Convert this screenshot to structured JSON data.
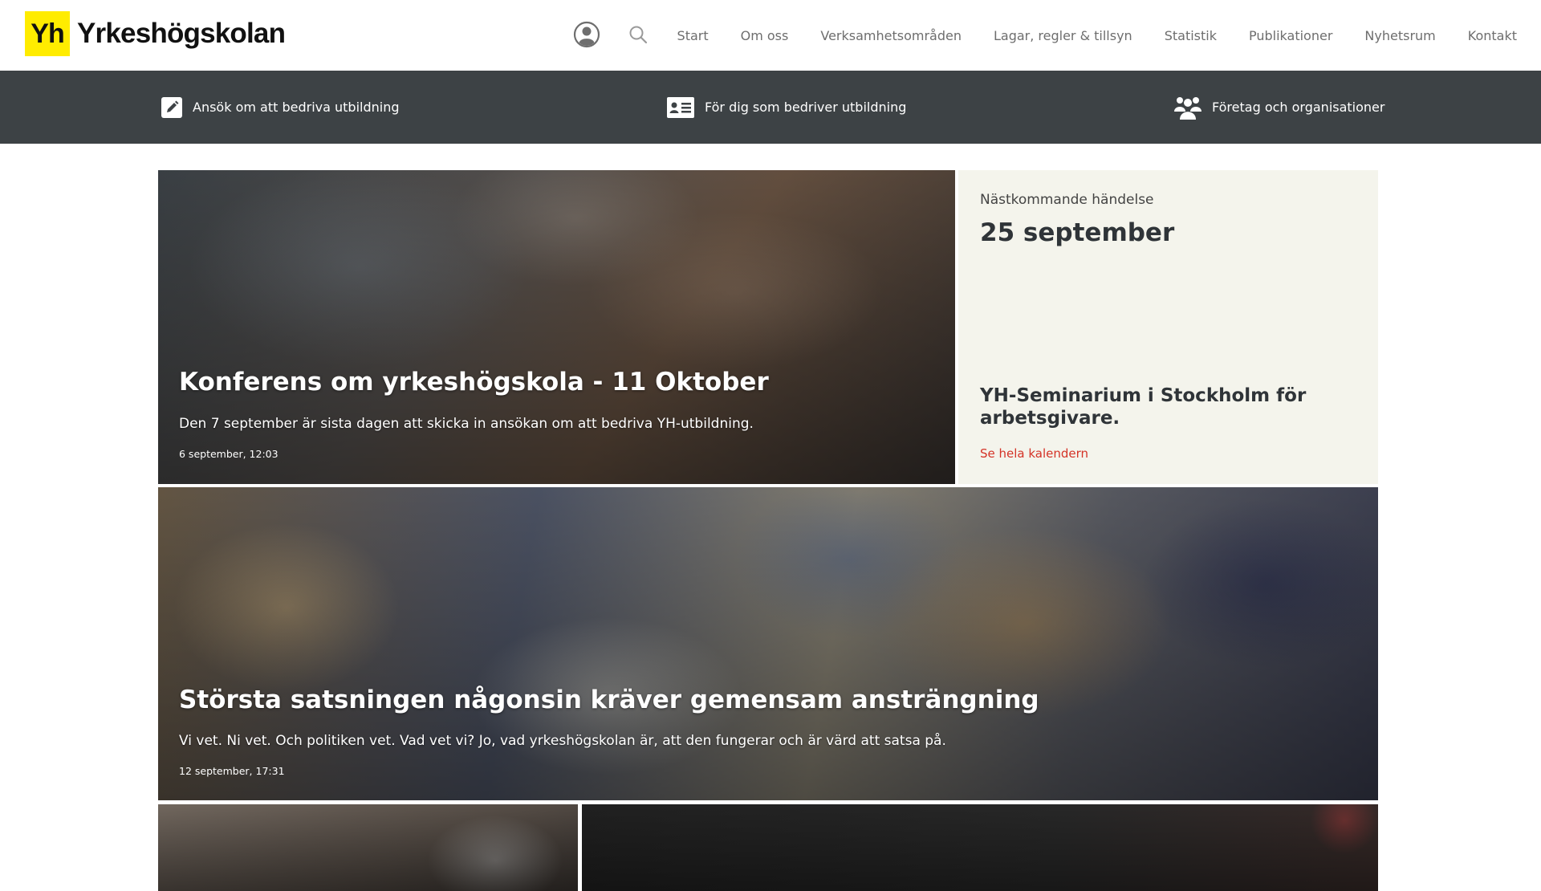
{
  "brand": {
    "logo_mark": "Yh",
    "logo_text": "Yrkeshögskolan",
    "accent": "#ffec00"
  },
  "header": {
    "icons": [
      "user-icon",
      "search-icon"
    ],
    "nav": [
      {
        "label": "Start"
      },
      {
        "label": "Om oss"
      },
      {
        "label": "Verksamhetsområden"
      },
      {
        "label": "Lagar, regler & tillsyn"
      },
      {
        "label": "Statistik"
      },
      {
        "label": "Publikationer"
      },
      {
        "label": "Nyhetsrum"
      },
      {
        "label": "Kontakt"
      }
    ]
  },
  "subnav": {
    "background": "#3d4245",
    "items": [
      {
        "label": "Ansök om att bedriva utbildning",
        "icon": "pencil-icon"
      },
      {
        "label": "För dig som bedriver utbildning",
        "icon": "id-card-icon"
      },
      {
        "label": "Företag och organisationer",
        "icon": "group-icon"
      }
    ]
  },
  "featured": [
    {
      "title": "Konferens om yrkeshögskola - 11 Oktober",
      "description": "Den 7 september är sista dagen att skicka in ansökan om att bedriva YH-utbildning.",
      "date": "6 september, 12:03"
    },
    {
      "title": "Största satsningen någonsin kräver gemensam ansträngning",
      "description": "Vi vet. Ni vet. Och politiken vet. Vad vet vi? Jo, vad yrkeshögskolan är, att den fungerar och är värd att satsa på.",
      "date": "12 september, 17:31"
    }
  ],
  "event": {
    "label": "Nästkommande händelse",
    "date": "25 september",
    "title": "YH-Seminarium i Stockholm för arbetsgivare.",
    "link": "Se hela kalendern",
    "link_color": "#d43327",
    "background": "#f4f4ec"
  }
}
